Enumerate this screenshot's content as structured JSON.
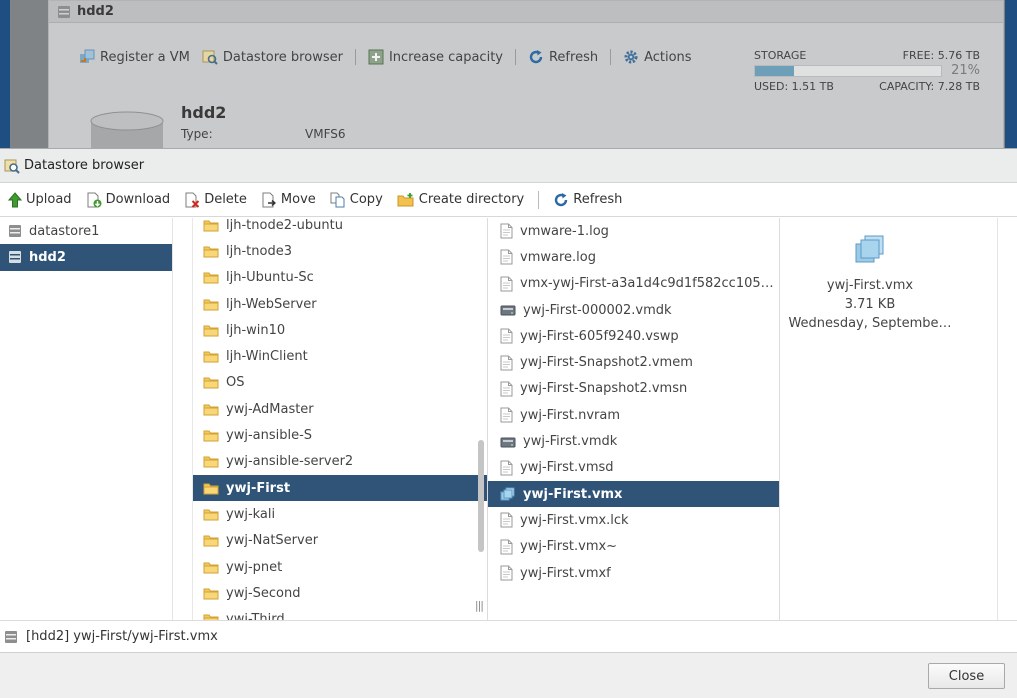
{
  "background": {
    "title": "hdd2",
    "toolbar": [
      {
        "label": "Register a VM",
        "icon": "register-vm-icon"
      },
      {
        "label": "Datastore browser",
        "icon": "datastore-browser-icon"
      },
      {
        "label": "Increase capacity",
        "icon": "increase-capacity-icon"
      },
      {
        "label": "Refresh",
        "icon": "refresh-icon"
      },
      {
        "label": "Actions",
        "icon": "gear-icon"
      }
    ],
    "storage": {
      "label": "STORAGE",
      "free": "FREE: 5.76 TB",
      "percent_label": "21%",
      "used_fraction": 0.21,
      "used": "USED: 1.51 TB",
      "capacity": "CAPACITY: 7.28 TB"
    },
    "datastore_name": "hdd2",
    "type_label": "Type:",
    "type_value": "VMFS6"
  },
  "dialog": {
    "title": "Datastore browser",
    "toolbar": {
      "upload": "Upload",
      "download": "Download",
      "delete": "Delete",
      "move": "Move",
      "copy": "Copy",
      "create_directory": "Create directory",
      "refresh": "Refresh"
    },
    "datastores": [
      {
        "label": "datastore1",
        "selected": false
      },
      {
        "label": "hdd2",
        "selected": true
      }
    ],
    "folders": [
      {
        "label": "ljh-tnode2-ubuntu",
        "selected": false
      },
      {
        "label": "ljh-tnode3",
        "selected": false
      },
      {
        "label": "ljh-Ubuntu-Sc",
        "selected": false
      },
      {
        "label": "ljh-WebServer",
        "selected": false
      },
      {
        "label": "ljh-win10",
        "selected": false
      },
      {
        "label": "ljh-WinClient",
        "selected": false
      },
      {
        "label": "OS",
        "selected": false
      },
      {
        "label": "ywj-AdMaster",
        "selected": false
      },
      {
        "label": "ywj-ansible-S",
        "selected": false
      },
      {
        "label": "ywj-ansible-server2",
        "selected": false
      },
      {
        "label": "ywj-First",
        "selected": true
      },
      {
        "label": "ywj-kali",
        "selected": false
      },
      {
        "label": "ywj-NatServer",
        "selected": false
      },
      {
        "label": "ywj-pnet",
        "selected": false
      },
      {
        "label": "ywj-Second",
        "selected": false
      },
      {
        "label": "ywj-Third",
        "selected": false
      }
    ],
    "files": [
      {
        "label": "vmware-1.log",
        "icon": "file-icon",
        "selected": false
      },
      {
        "label": "vmware.log",
        "icon": "file-icon",
        "selected": false
      },
      {
        "label": "vmx-ywj-First-a3a1d4c9d1f582cc105…",
        "icon": "file-icon",
        "selected": false
      },
      {
        "label": "ywj-First-000002.vmdk",
        "icon": "disk-icon",
        "selected": false
      },
      {
        "label": "ywj-First-605f9240.vswp",
        "icon": "file-icon",
        "selected": false
      },
      {
        "label": "ywj-First-Snapshot2.vmem",
        "icon": "file-icon",
        "selected": false
      },
      {
        "label": "ywj-First-Snapshot2.vmsn",
        "icon": "file-icon",
        "selected": false
      },
      {
        "label": "ywj-First.nvram",
        "icon": "file-icon",
        "selected": false
      },
      {
        "label": "ywj-First.vmdk",
        "icon": "disk-icon",
        "selected": false
      },
      {
        "label": "ywj-First.vmsd",
        "icon": "file-icon",
        "selected": false
      },
      {
        "label": "ywj-First.vmx",
        "icon": "vm-icon",
        "selected": true
      },
      {
        "label": "ywj-First.vmx.lck",
        "icon": "file-icon",
        "selected": false
      },
      {
        "label": "ywj-First.vmx~",
        "icon": "file-icon",
        "selected": false
      },
      {
        "label": "ywj-First.vmxf",
        "icon": "file-icon",
        "selected": false
      }
    ],
    "preview": {
      "name": "ywj-First.vmx",
      "size": "3.71 KB",
      "date": "Wednesday, Septembe…"
    },
    "status_path": "[hdd2] ywj-First/ywj-First.vmx",
    "close_label": "Close"
  }
}
